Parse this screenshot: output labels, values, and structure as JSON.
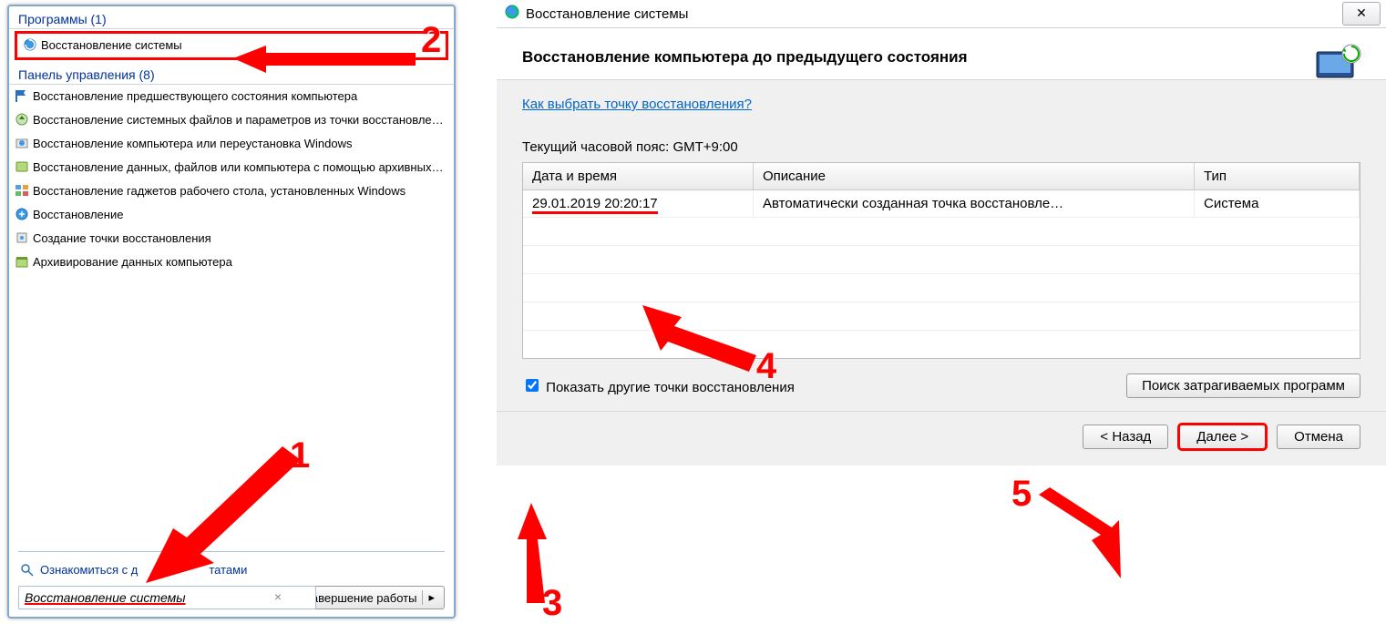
{
  "annotations": {
    "n1": "1",
    "n2": "2",
    "n3": "3",
    "n4": "4",
    "n5": "5"
  },
  "left": {
    "programs_header": "Программы (1)",
    "system_restore": "Восстановление системы",
    "control_panel_header": "Панель управления (8)",
    "items": [
      "Восстановление предшествующего состояния компьютера",
      "Восстановление системных файлов и параметров из точки восстановления",
      "Восстановление компьютера или переустановка Windows",
      "Восстановление данных, файлов или компьютера с помощью архивных ко…",
      "Восстановление гаджетов рабочего стола, установленных Windows",
      "Восстановление",
      "Создание точки восстановления",
      "Архивирование данных компьютера"
    ],
    "results_link_prefix": "Ознакомиться с д",
    "results_link_suffix": "татами",
    "search_value": "Восстановление системы",
    "shutdown_label": "Завершение работы"
  },
  "right": {
    "titlebar": "Восстановление системы",
    "header_title": "Восстановление компьютера до предыдущего состояния",
    "help_link": "Как выбрать точку восстановления?",
    "timezone": "Текущий часовой пояс: GMT+9:00",
    "table": {
      "col_date": "Дата и время",
      "col_desc": "Описание",
      "col_type": "Тип",
      "row_date": "29.01.2019 20:20:17",
      "row_desc": "Автоматически созданная точка восстановле…",
      "row_type": "Система"
    },
    "show_other_label": "Показать другие точки восстановления",
    "affected_label": "Поиск затрагиваемых программ",
    "back": "< Назад",
    "next": "Далее >",
    "cancel": "Отмена"
  }
}
